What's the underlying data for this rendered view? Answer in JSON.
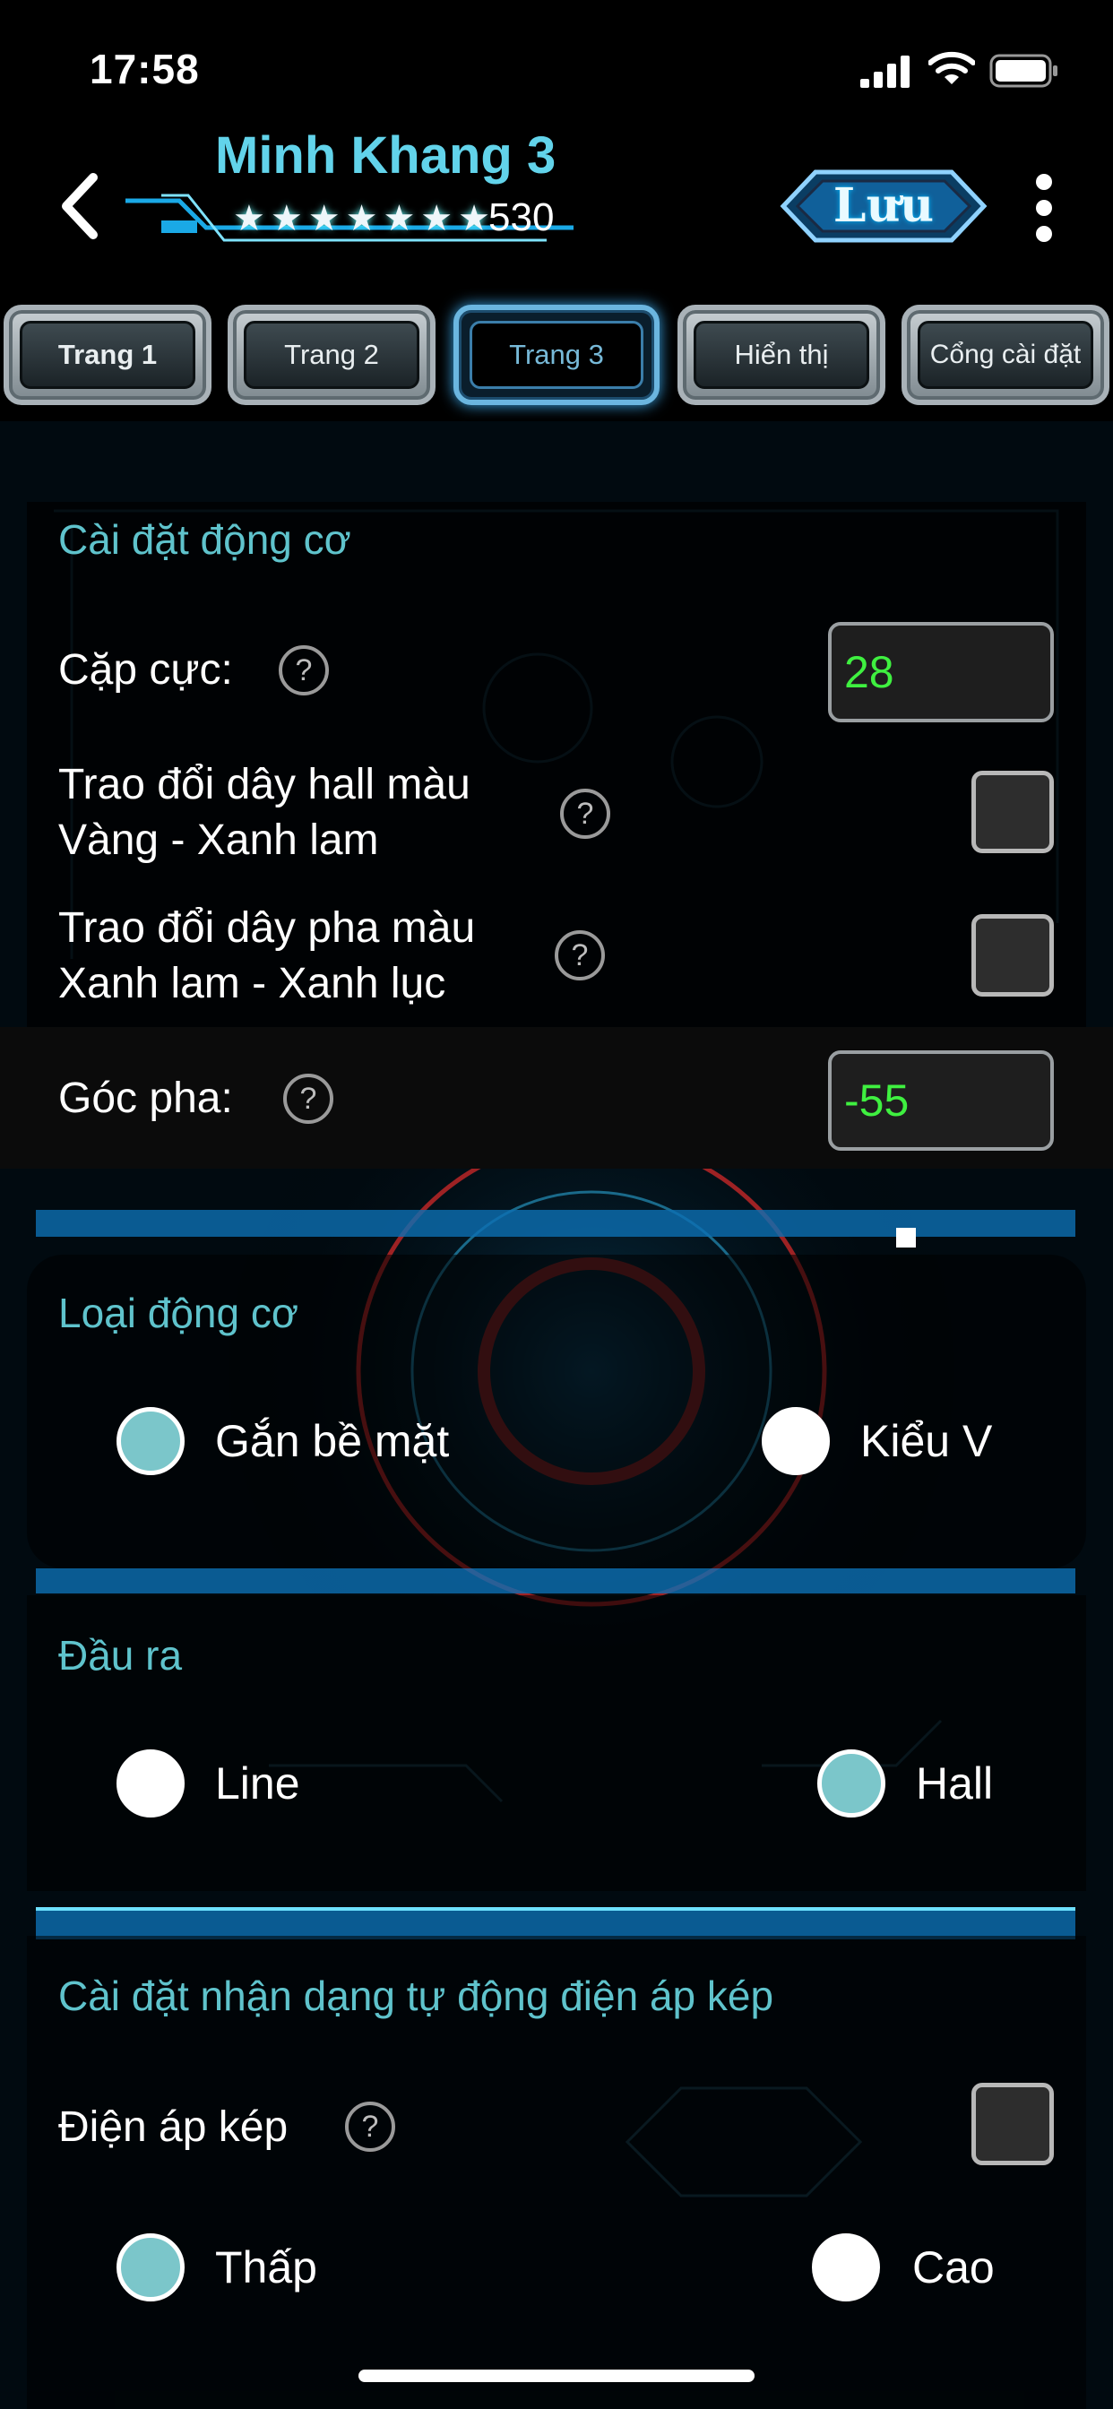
{
  "status_bar": {
    "time": "17:58"
  },
  "header": {
    "title": "Minh Khang 3",
    "stars": [
      "★",
      "★",
      "★",
      "★",
      "★",
      "★",
      "★"
    ],
    "points": "530",
    "save_label": "Lưu"
  },
  "tabs": [
    {
      "label": "Trang 1",
      "active": false
    },
    {
      "label": "Trang 2",
      "active": false
    },
    {
      "label": "Trang 3",
      "active": true
    },
    {
      "label": "Hiển thị",
      "active": false
    },
    {
      "label": "Cổng cài đặt",
      "active": false
    }
  ],
  "motor_settings": {
    "title": "Cài đặt động cơ",
    "pole_pairs_label": "Cặp cực:",
    "pole_pairs_value": "28",
    "swap_hall_label": [
      "Trao đổi dây hall màu",
      "Vàng - Xanh lam"
    ],
    "swap_phase_label": [
      "Trao đổi dây pha màu",
      "Xanh lam - Xanh lục"
    ],
    "phase_angle_label": "Góc pha:",
    "phase_angle_value": "-55",
    "help_symbol": "?"
  },
  "motor_type": {
    "title": "Loại động cơ",
    "options": [
      {
        "label": "Gắn bề mặt",
        "selected": true
      },
      {
        "label": "Kiểu V",
        "selected": false
      }
    ]
  },
  "output": {
    "title": "Đầu ra",
    "options": [
      {
        "label": "Line",
        "selected": false
      },
      {
        "label": "Hall",
        "selected": true
      }
    ]
  },
  "dual_voltage": {
    "title": "Cài đặt nhận dạng tự động điện áp kép",
    "dual_label": "Điện áp kép",
    "options": [
      {
        "label": "Thấp",
        "selected": true
      },
      {
        "label": "Cao",
        "selected": false
      }
    ]
  },
  "colors": {
    "accent": "#62d3ea",
    "section_title": "#5fc3cc",
    "value_green": "#3ff040",
    "radio_on": "#7bc6ca"
  }
}
